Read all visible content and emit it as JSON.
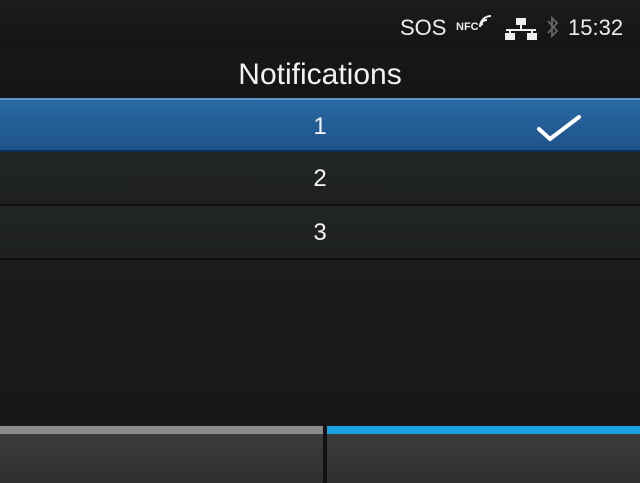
{
  "status_bar": {
    "sos_label": "SOS",
    "nfc_label": "NFC",
    "nfc_signal_icon": "nfc-signal-icon",
    "network_icon": "lan-network-icon",
    "bluetooth_icon": "bluetooth-icon",
    "time": "15:32"
  },
  "header": {
    "title": "Notifications"
  },
  "list": {
    "items": [
      {
        "label": "1",
        "selected": true
      },
      {
        "label": "2",
        "selected": false
      },
      {
        "label": "3",
        "selected": false
      }
    ],
    "selected_check_icon": "checkmark-icon"
  },
  "softkeys": {
    "left": {
      "label": "",
      "accent": "#8a8a8a"
    },
    "right": {
      "icon": "checkmark-icon",
      "accent": "#1aa1e3"
    }
  },
  "colors": {
    "selected_row": "#2a69a3",
    "background": "#1a1a1a",
    "text": "#f4f4f4"
  }
}
